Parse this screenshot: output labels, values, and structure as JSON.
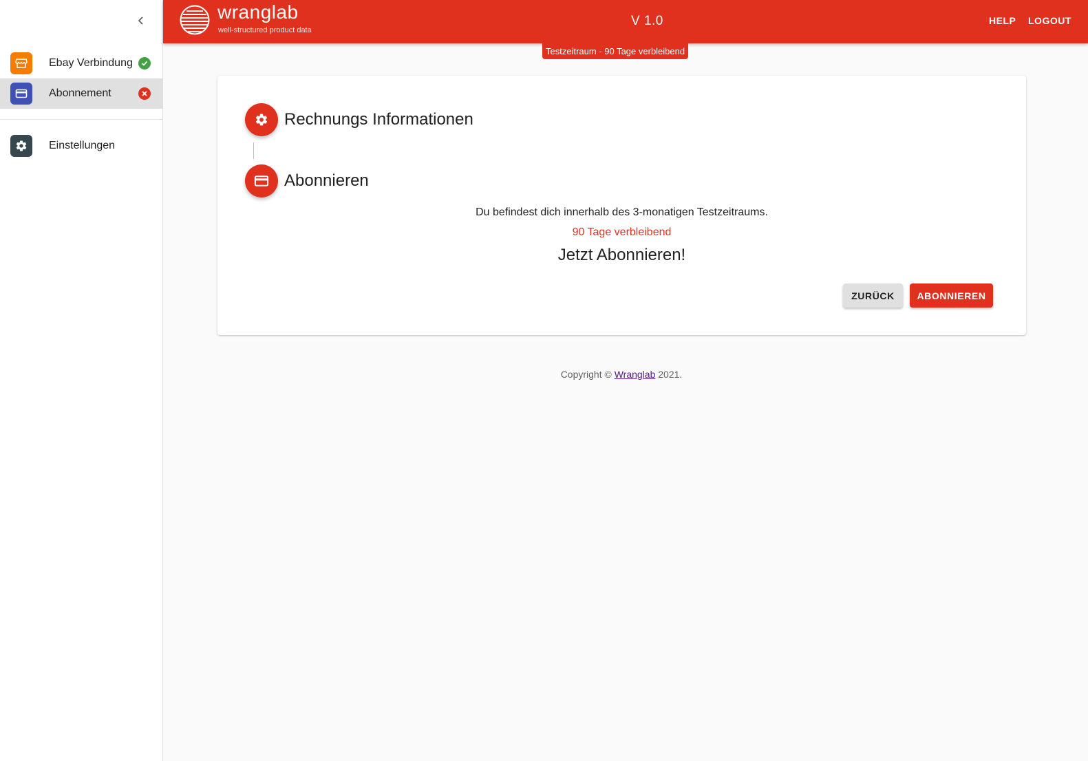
{
  "sidebar": {
    "items": [
      {
        "label": "Ebay Verbindung",
        "status": "connected"
      },
      {
        "label": "Abonnement",
        "status": "error"
      },
      {
        "label": "Einstellungen"
      }
    ]
  },
  "header": {
    "brand_name": "wranglab",
    "brand_tagline": "well-structured product data",
    "version": "V 1.0",
    "help_label": "HELP",
    "logout_label": "LOGOUT",
    "trial_badge": "Testzeitraum - 90 Tage verbleibend"
  },
  "stepper": {
    "steps": [
      {
        "title": "Rechnungs Informationen",
        "icon": "gear-icon"
      },
      {
        "title": "Abonnieren",
        "icon": "credit-card-icon"
      }
    ]
  },
  "subscribe": {
    "info_text": "Du befindest dich innerhalb des 3-monatigen Testzeitraums.",
    "remaining_text": "90 Tage verbleibend",
    "cta_heading": "Jetzt Abonnieren!",
    "back_label": "ZURÜCK",
    "subscribe_label": "ABONNIEREN"
  },
  "footer": {
    "prefix": "Copyright ©",
    "link_label": "Wranglab",
    "suffix": "2021."
  },
  "colors": {
    "brand_red": "#e0301e",
    "store_orange": "#f57c00",
    "card_indigo": "#3f51b5",
    "settings_dark": "#37474f",
    "success_green": "#43a047"
  }
}
